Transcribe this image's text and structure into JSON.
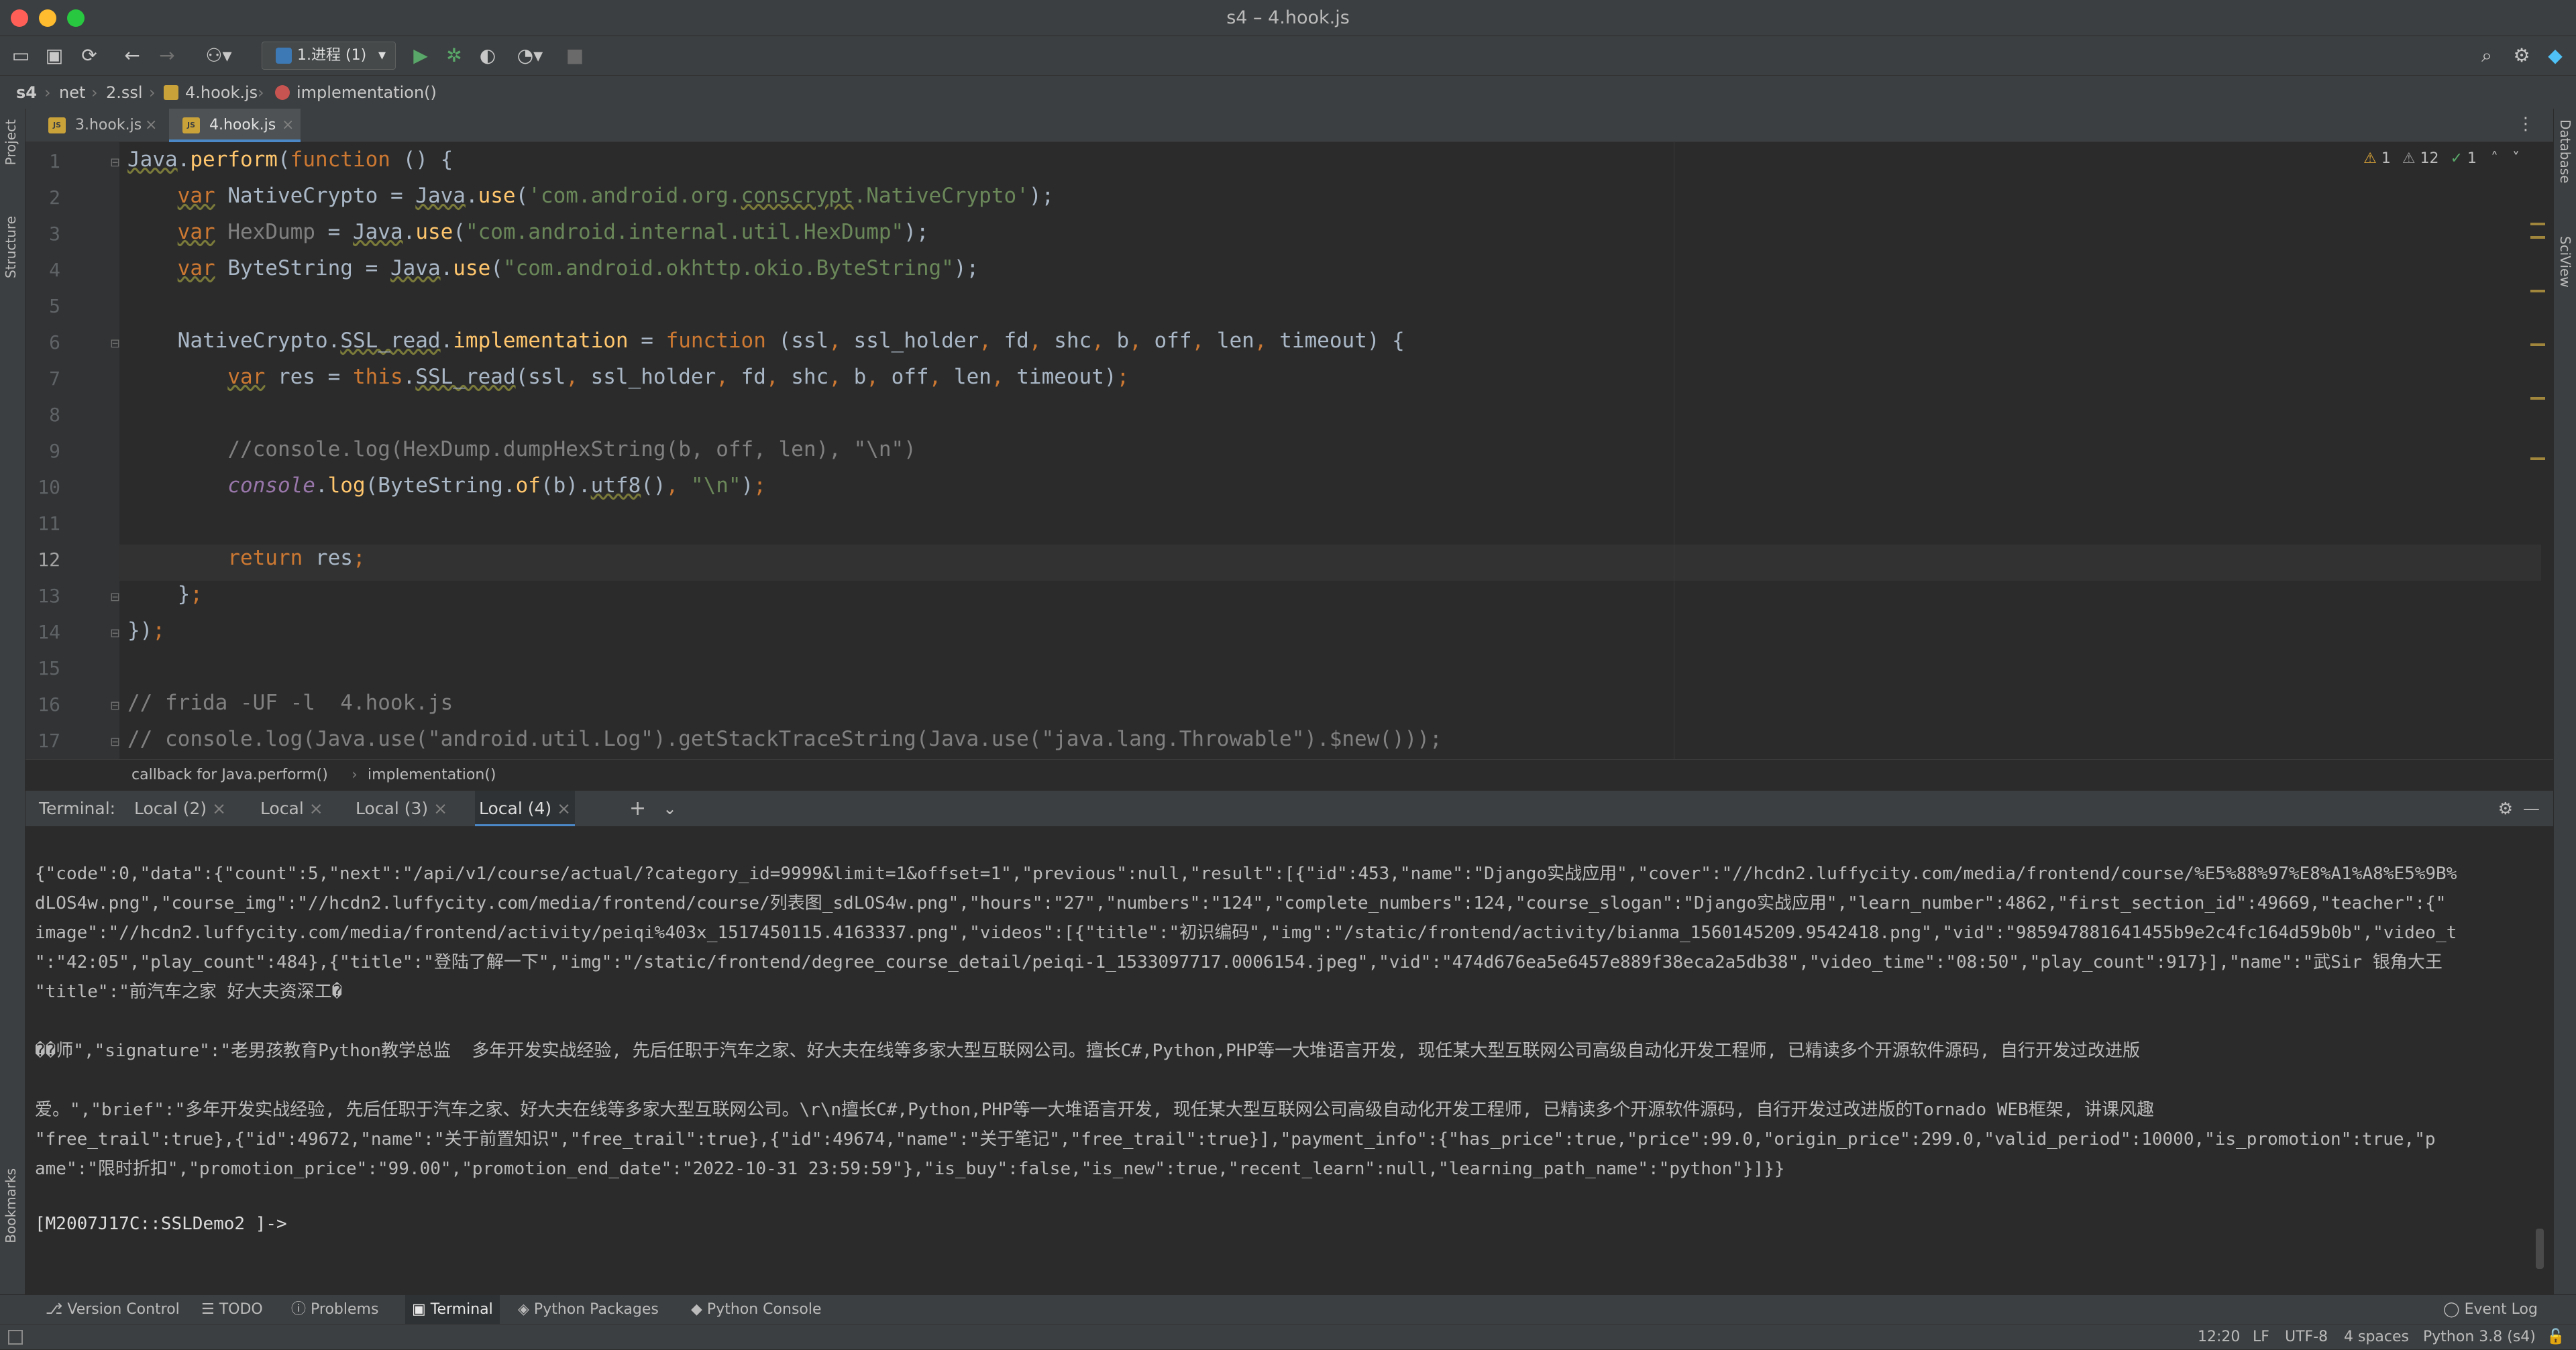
{
  "window": {
    "title": "s4 – 4.hook.js"
  },
  "toolbar": {
    "run_config": "1.进程 (1)"
  },
  "breadcrumbs": [
    "s4",
    "net",
    "2.ssl",
    "4.hook.js",
    "implementation()"
  ],
  "side": {
    "project": "Project",
    "structure": "Structure",
    "bookmarks": "Bookmarks",
    "database": "Database",
    "sciview": "SciView"
  },
  "tabs": [
    {
      "label": "3.hook.js"
    },
    {
      "label": "4.hook.js",
      "active": true
    }
  ],
  "inspections": {
    "warnings": "1",
    "weak_warnings": "12",
    "ok": "1"
  },
  "editor": {
    "current_line": 12,
    "line_numbers": [
      "1",
      "2",
      "3",
      "4",
      "5",
      "6",
      "7",
      "8",
      "9",
      "10",
      "11",
      "12",
      "13",
      "14",
      "15",
      "16",
      "17"
    ]
  },
  "editor_breadcrumb": [
    "callback for Java.perform()",
    "implementation()"
  ],
  "terminal": {
    "label": "Terminal:",
    "tabs": [
      "Local (2)",
      "Local",
      "Local (3)",
      "Local (4)"
    ],
    "active_tab": "Local (4)",
    "lines": [
      "{\"code\":0,\"data\":{\"count\":5,\"next\":\"/api/v1/course/actual/?category_id=9999&limit=1&offset=1\",\"previous\":null,\"result\":[{\"id\":453,\"name\":\"Django实战应用\",\"cover\":\"//hcdn2.luffycity.com/media/frontend/course/%E5%88%97%E8%A1%A8%E5%9B%",
      "dLOS4w.png\",\"course_img\":\"//hcdn2.luffycity.com/media/frontend/course/列表图_sdLOS4w.png\",\"hours\":\"27\",\"numbers\":\"124\",\"complete_numbers\":124,\"course_slogan\":\"Django实战应用\",\"learn_number\":4862,\"first_section_id\":49669,\"teacher\":{\"",
      "image\":\"//hcdn2.luffycity.com/media/frontend/activity/peiqi%403x_1517450115.4163337.png\",\"videos\":[{\"title\":\"初识编码\",\"img\":\"/static/frontend/activity/bianma_1560145209.9542418.png\",\"vid\":\"985947881641455b9e2c4fc164d59b0b\",\"video_t",
      "\":\"42:05\",\"play_count\":484},{\"title\":\"登陆了解一下\",\"img\":\"/static/frontend/degree_course_detail/peiqi-1_1533097717.0006154.jpeg\",\"vid\":\"474d676ea5e6457e889f38eca2a5db38\",\"video_time\":\"08:50\",\"play_count\":917}],\"name\":\"武Sir 银角大王",
      "\"title\":\"前汽车之家 好大夫资深工�",
      "",
      "��师\",\"signature\":\"老男孩教育Python教学总监  多年开发实战经验, 先后任职于汽车之家、好大夫在线等多家大型互联网公司。擅长C#,Python,PHP等一大堆语言开发, 现任某大型互联网公司高级自动化开发工程师, 已精读多个开源软件源码, 自行开发过改进版",
      "",
      "爱。\",\"brief\":\"多年开发实战经验, 先后任职于汽车之家、好大夫在线等多家大型互联网公司。\\r\\n擅长C#,Python,PHP等一大堆语言开发, 现任某大型互联网公司高级自动化开发工程师, 已精读多个开源软件源码, 自行开发过改进版的Tornado WEB框架, 讲课风趣",
      "\"free_trail\":true},{\"id\":49672,\"name\":\"关于前置知识\",\"free_trail\":true},{\"id\":49674,\"name\":\"关于笔记\",\"free_trail\":true}],\"payment_info\":{\"has_price\":true,\"price\":99.0,\"origin_price\":299.0,\"valid_period\":10000,\"is_promotion\":true,\"p",
      "ame\":\"限时折扣\",\"promotion_price\":\"99.00\",\"promotion_end_date\":\"2022-10-31 23:59:59\"},\"is_buy\":false,\"is_new\":true,\"recent_learn\":null,\"learning_path_name\":\"python\"}]}}",
      "",
      "[M2007J17C::SSLDemo2 ]->"
    ]
  },
  "tool_windows": [
    "Version Control",
    "TODO",
    "Problems",
    "Terminal",
    "Python Packages",
    "Python Console"
  ],
  "event_log": "Event Log",
  "status": {
    "position": "12:20",
    "line_sep": "LF",
    "encoding": "UTF-8",
    "indent": "4 spaces",
    "interpreter": "Python 3.8 (s4)"
  },
  "colors": {
    "keyword": "#cc7832",
    "string": "#6a8759",
    "comment": "#808080",
    "function": "#ffc66d",
    "accent": "#4a88c7"
  }
}
